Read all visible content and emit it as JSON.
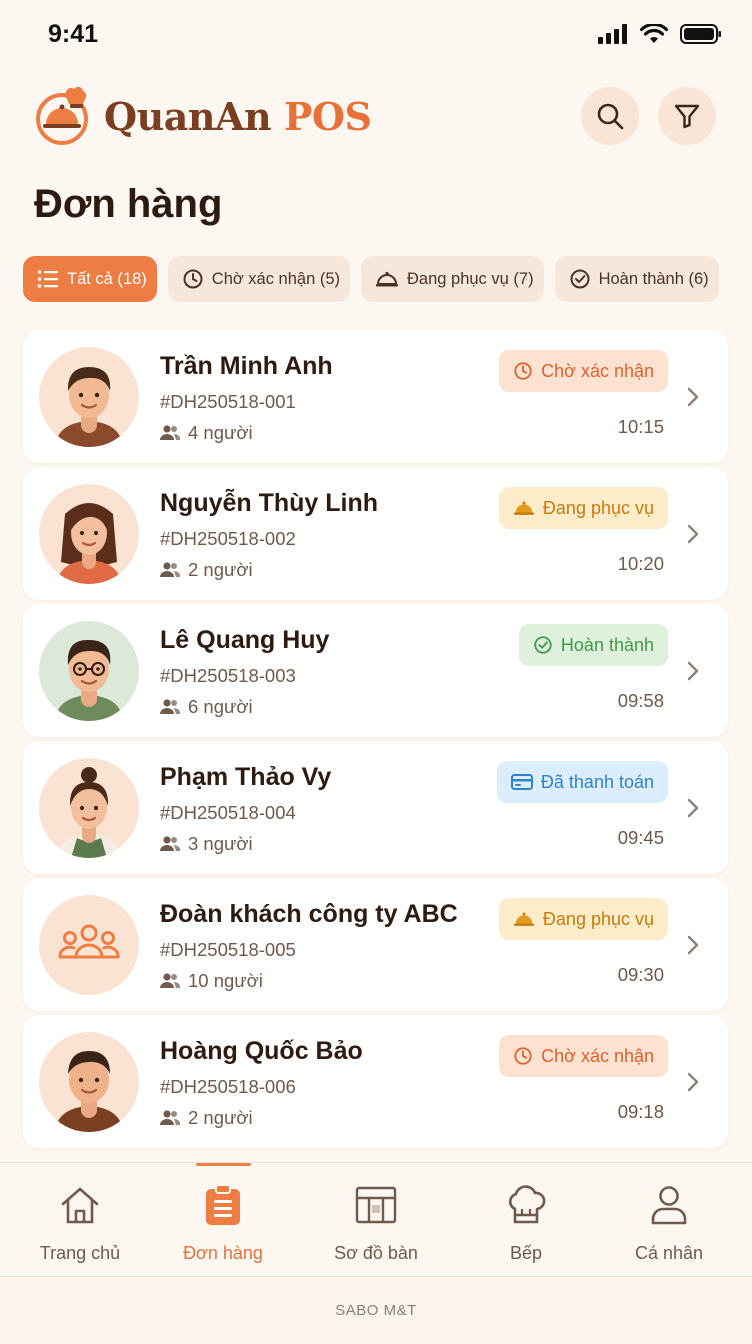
{
  "status_bar": {
    "time": "9:41"
  },
  "header": {
    "brand_main": "QuanAn",
    "brand_accent": "POS",
    "page_title": "Đơn hàng"
  },
  "tabs": [
    {
      "label": "Tất cả (18)",
      "icon": "list-icon",
      "active": true
    },
    {
      "label": "Chờ xác nhận (5)",
      "icon": "clock-icon",
      "active": false
    },
    {
      "label": "Đang phục vụ (7)",
      "icon": "cloche-icon",
      "active": false
    },
    {
      "label": "Hoàn thành (6)",
      "icon": "check-circle-icon",
      "active": false
    }
  ],
  "orders": [
    {
      "name": "Trần Minh Anh",
      "code": "#DH250518-001",
      "people": "4 người",
      "time": "10:15",
      "status": "Chờ xác nhận",
      "status_type": "wait"
    },
    {
      "name": "Nguyễn Thùy Linh",
      "code": "#DH250518-002",
      "people": "2 người",
      "time": "10:20",
      "status": "Đang phục vụ",
      "status_type": "serve"
    },
    {
      "name": "Lê Quang Huy",
      "code": "#DH250518-003",
      "people": "6 người",
      "time": "09:58",
      "status": "Hoàn thành",
      "status_type": "done"
    },
    {
      "name": "Phạm Thảo Vy",
      "code": "#DH250518-004",
      "people": "3 người",
      "time": "09:45",
      "status": "Đã thanh toán",
      "status_type": "paid"
    },
    {
      "name": "Đoàn khách công ty ABC",
      "code": "#DH250518-005",
      "people": "10 người",
      "time": "09:30",
      "status": "Đang phục vụ",
      "status_type": "serve"
    },
    {
      "name": "Hoàng Quốc Bảo",
      "code": "#DH250518-006",
      "people": "2 người",
      "time": "09:18",
      "status": "Chờ xác nhận",
      "status_type": "wait"
    }
  ],
  "bottom_nav": [
    {
      "label": "Trang chủ",
      "icon": "home-icon",
      "active": false
    },
    {
      "label": "Đơn hàng",
      "icon": "clipboard-icon",
      "active": true
    },
    {
      "label": "Sơ đồ bàn",
      "icon": "table-map-icon",
      "active": false
    },
    {
      "label": "Bếp",
      "icon": "chef-hat-icon",
      "active": false
    },
    {
      "label": "Cá nhân",
      "icon": "user-icon",
      "active": false
    }
  ],
  "footer": {
    "text": "SABO M&T"
  },
  "colors": {
    "accent": "#ee7d44",
    "background": "#fdf7f1",
    "wait": "#e0612b",
    "serve": "#c57b0e",
    "done": "#3f9a4a",
    "paid": "#2d84c9"
  }
}
